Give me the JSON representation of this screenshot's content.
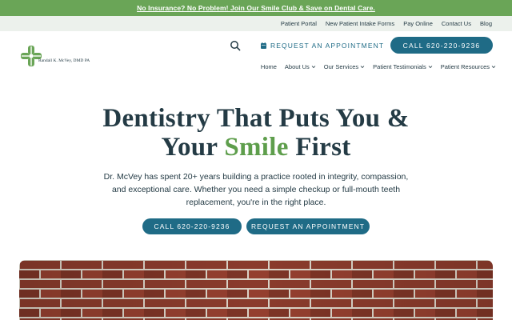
{
  "promo": {
    "text": "No Insurance? No Problem! Join Our Smile Club & Save on Dental Care."
  },
  "utility_nav": [
    {
      "label": "Patient Portal"
    },
    {
      "label": "New Patient Intake Forms"
    },
    {
      "label": "Pay Online"
    },
    {
      "label": "Contact Us"
    },
    {
      "label": "Blog"
    }
  ],
  "logo": {
    "text": "Randall K. McVey, DMD PA",
    "color": "#6aa557"
  },
  "header": {
    "search_icon": "search-icon",
    "appointment_label": "REQUEST AN APPOINTMENT",
    "appointment_icon": "calendar-icon",
    "call_label": "CALL 620-220-9236"
  },
  "main_nav": [
    {
      "label": "Home",
      "has_dropdown": false
    },
    {
      "label": "About Us",
      "has_dropdown": true
    },
    {
      "label": "Our Services",
      "has_dropdown": true
    },
    {
      "label": "Patient Testimonials",
      "has_dropdown": true
    },
    {
      "label": "Patient Resources",
      "has_dropdown": true
    }
  ],
  "hero": {
    "title_line1": "Dentistry That Puts You &",
    "title_before": "Your ",
    "title_accent": "Smile",
    "title_after": " First",
    "body": "Dr. McVey has spent 20+ years building a practice rooted in integrity, compassion, and exceptional care. Whether you need a simple checkup or full-mouth teeth replacement, you're in the right place.",
    "cta_call": "CALL 620-220-9236",
    "cta_appointment": "REQUEST AN APPOINTMENT"
  },
  "colors": {
    "brand_green": "#6aa557",
    "brand_blue": "#1f6b86",
    "text_dark": "#243b45",
    "utility_bg": "#ecf1ec",
    "brick": "#8a3b2c"
  }
}
